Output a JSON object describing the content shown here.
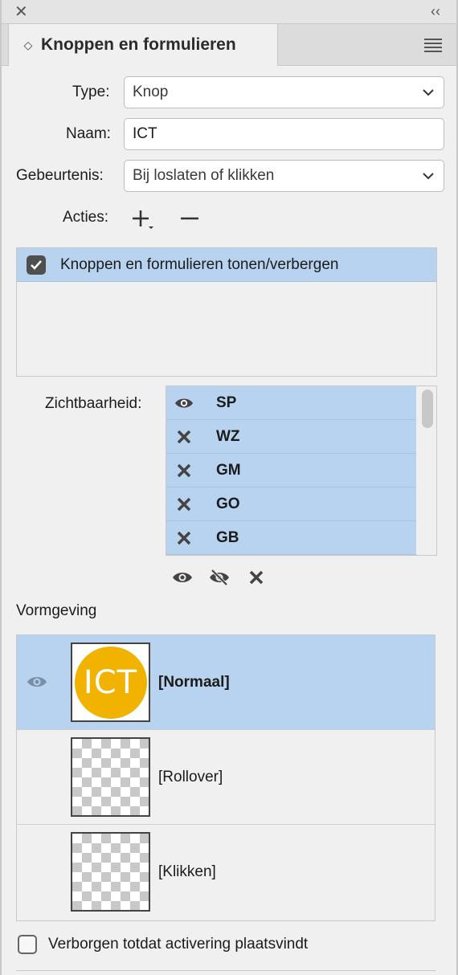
{
  "panel": {
    "title": "Knoppen en formulieren"
  },
  "form": {
    "type_label": "Type:",
    "type_value": "Knop",
    "name_label": "Naam:",
    "name_value": "ICT",
    "event_label": "Gebeurtenis:",
    "event_value": "Bij loslaten of klikken",
    "actions_label": "Acties:"
  },
  "actions": [
    {
      "label": "Knoppen en formulieren tonen/verbergen",
      "checked": true
    }
  ],
  "visibility": {
    "label": "Zichtbaarheid:",
    "items": [
      {
        "name": "SP",
        "icon": "eye-icon"
      },
      {
        "name": "WZ",
        "icon": "x-icon"
      },
      {
        "name": "GM",
        "icon": "x-icon"
      },
      {
        "name": "GO",
        "icon": "x-icon"
      },
      {
        "name": "GB",
        "icon": "x-icon"
      }
    ]
  },
  "appearance": {
    "title": "Vormgeving",
    "states": [
      {
        "name": "[Normaal]",
        "selected": true,
        "thumb_text": "ICT"
      },
      {
        "name": "[Rollover]",
        "selected": false
      },
      {
        "name": "[Klikken]",
        "selected": false
      }
    ]
  },
  "footer": {
    "hidden_label": "Verborgen totdat activering plaatsvindt"
  },
  "colors": {
    "selection": "#b8d3f0",
    "ict_yellow": "#f2b200"
  }
}
